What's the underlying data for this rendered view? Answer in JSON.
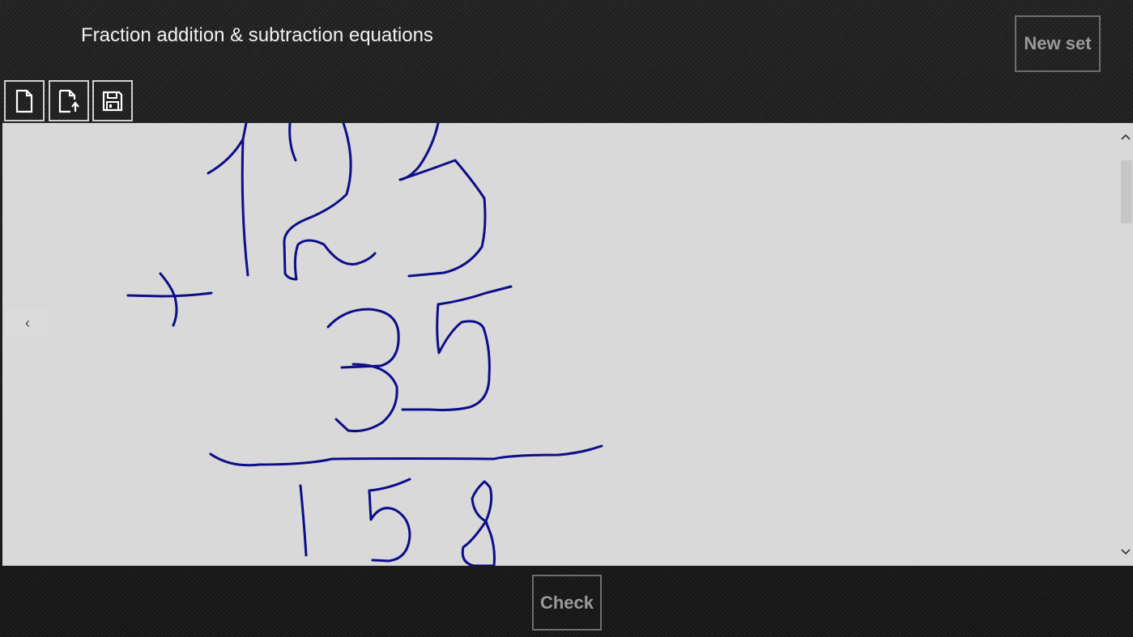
{
  "header": {
    "title": "Fraction addition & subtraction equations",
    "new_set_label": "New set"
  },
  "toolbar": {
    "items": [
      {
        "name": "new-document",
        "icon": "new-document-icon"
      },
      {
        "name": "open-document",
        "icon": "open-document-icon"
      },
      {
        "name": "save",
        "icon": "save-icon"
      }
    ]
  },
  "canvas": {
    "background": "#d9d9d9",
    "ink_color": "#0d0d8a",
    "collapse_glyph": "‹"
  },
  "footer": {
    "check_label": "Check"
  }
}
